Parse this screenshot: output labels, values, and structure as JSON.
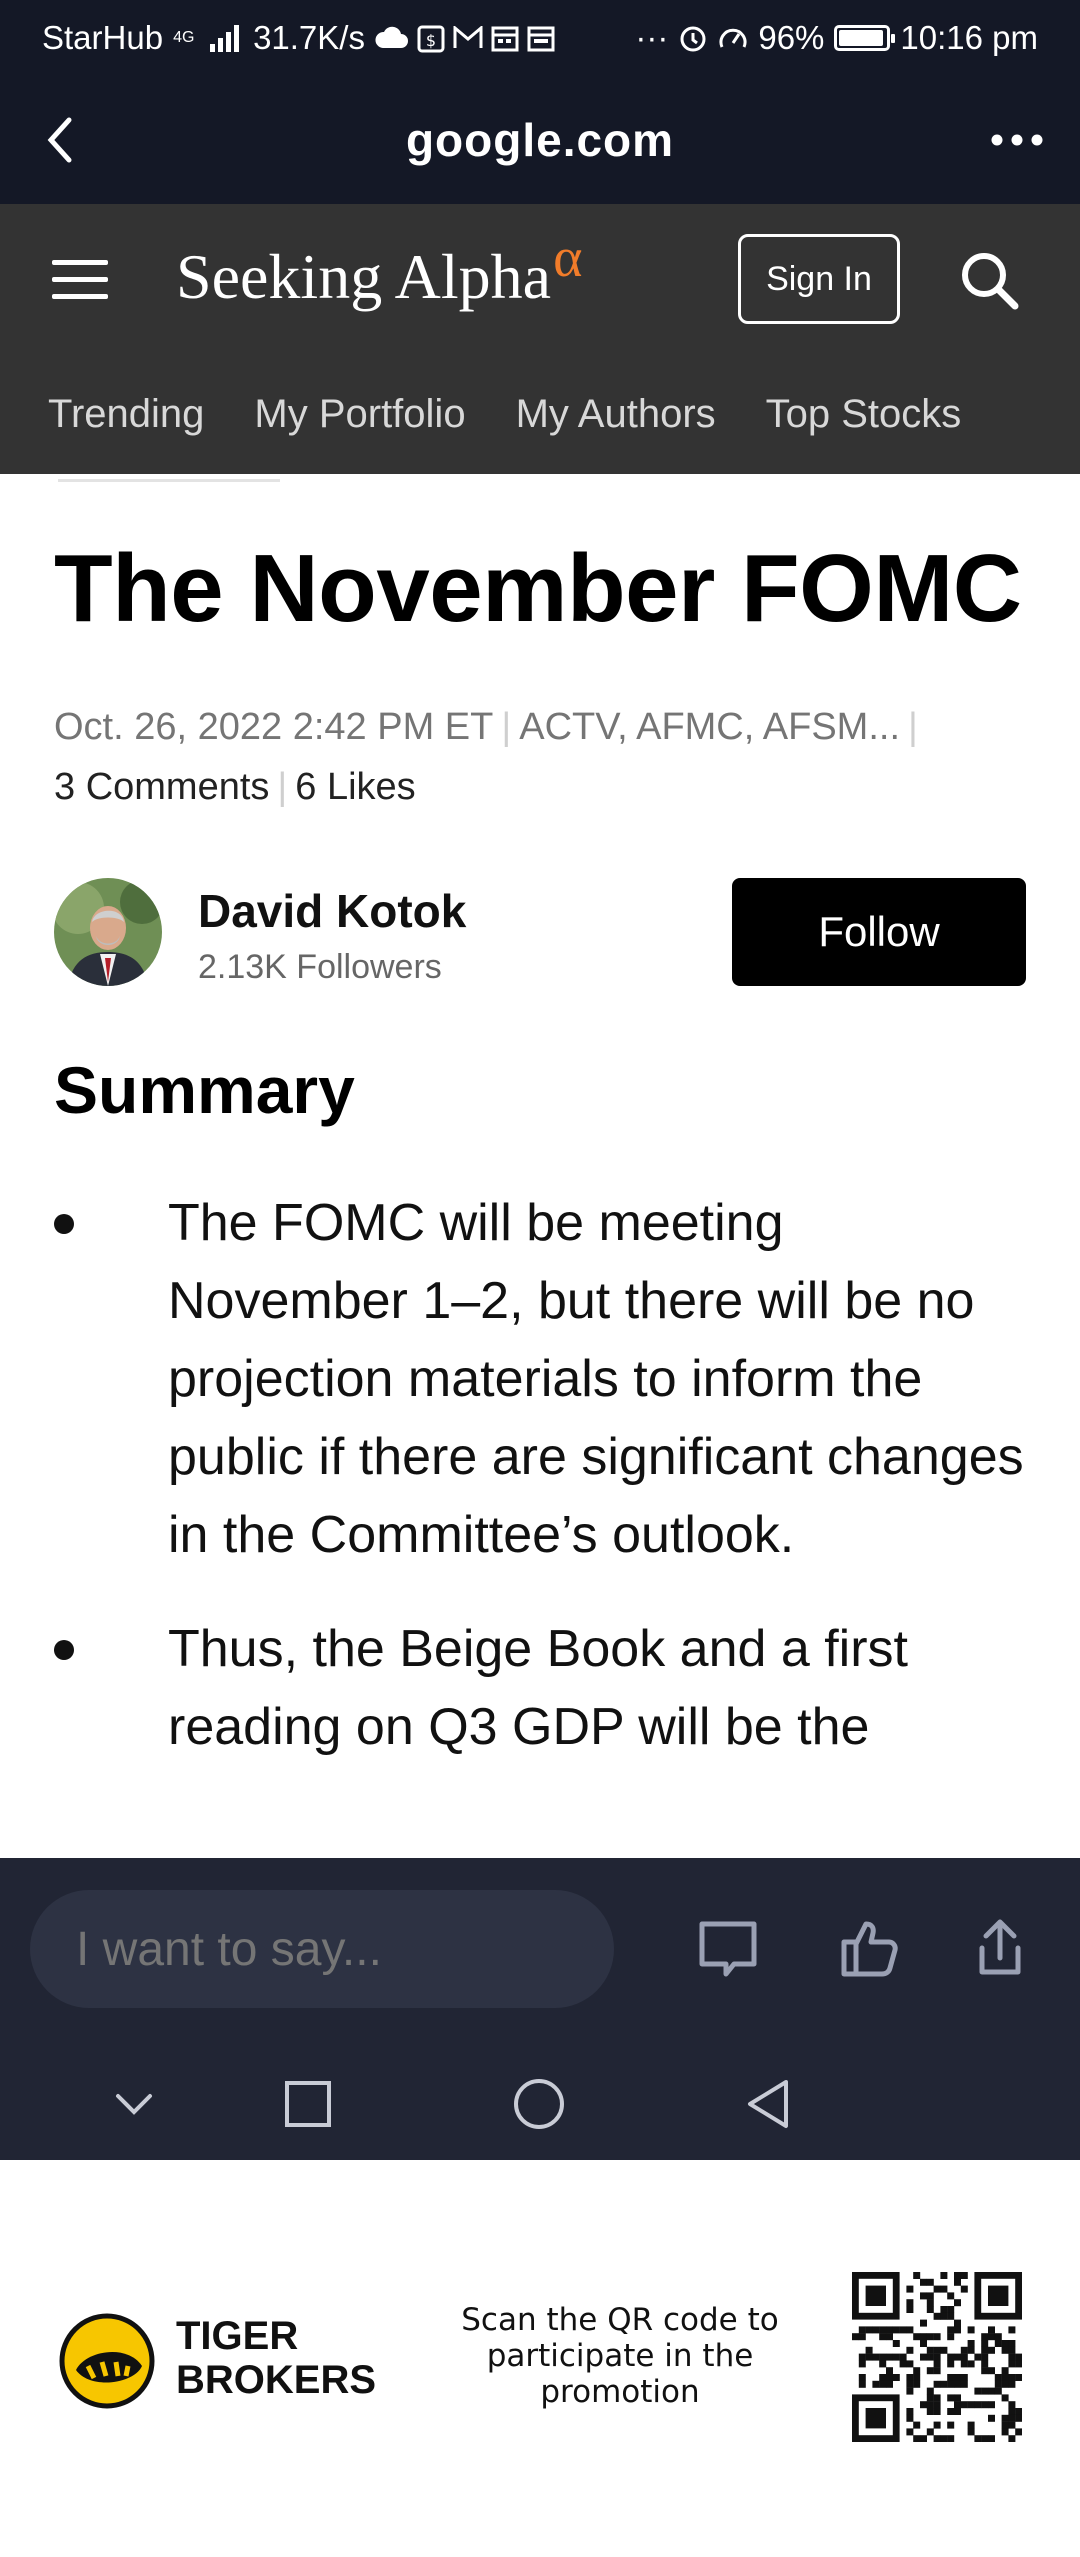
{
  "status_bar": {
    "carrier": "StarHub",
    "network": "4G",
    "speed": "31.7K/s",
    "battery": "96%",
    "battery_level": 0.96,
    "time": "10:16 pm",
    "icons": [
      "cloud-icon",
      "wallet-icon",
      "gmail-icon",
      "calendar-icon",
      "calendar-icon",
      "more-dots-icon",
      "alarm-icon",
      "speedometer-icon"
    ]
  },
  "browser": {
    "url_title": "google.com",
    "back_icon": "chevron-left-icon",
    "menu_icon": "more-dots-icon"
  },
  "site_header": {
    "brand_name": "Seeking Alpha",
    "brand_mark": "α",
    "brand_accent": "#f17c2a",
    "sign_in_label": "Sign In",
    "nav_items": [
      "Trending",
      "My Portfolio",
      "My Authors",
      "Top Stocks"
    ]
  },
  "article": {
    "title": "The November FOMC",
    "date": "Oct. 26, 2022 2:42 PM ET",
    "tickers": "ACTV, AFMC, AFSM...",
    "comments": "3 Comments",
    "likes": "6 Likes",
    "author": {
      "name": "David Kotok",
      "followers": "2.13K Followers",
      "follow_label": "Follow"
    },
    "summary_heading": "Summary",
    "summary_points": [
      "The FOMC will be meeting November 1–2, but there will be no projection materials to inform the public if there are significant changes in the Committee’s outlook.",
      "Thus, the Beige Book and a first reading on Q3 GDP will be the"
    ]
  },
  "comment_bar": {
    "placeholder": "I want to say...",
    "icons": [
      "comment-icon",
      "thumbs-up-icon",
      "share-icon"
    ]
  },
  "system_nav": {
    "icons": [
      "chevron-down-icon",
      "recents-square-icon",
      "home-circle-icon",
      "back-triangle-icon"
    ]
  },
  "ad_footer": {
    "brand_line1": "TIGER",
    "brand_line2": "BROKERS",
    "cta": "Scan the QR code to participate in the promotion",
    "logo_color": "#f7c600"
  }
}
